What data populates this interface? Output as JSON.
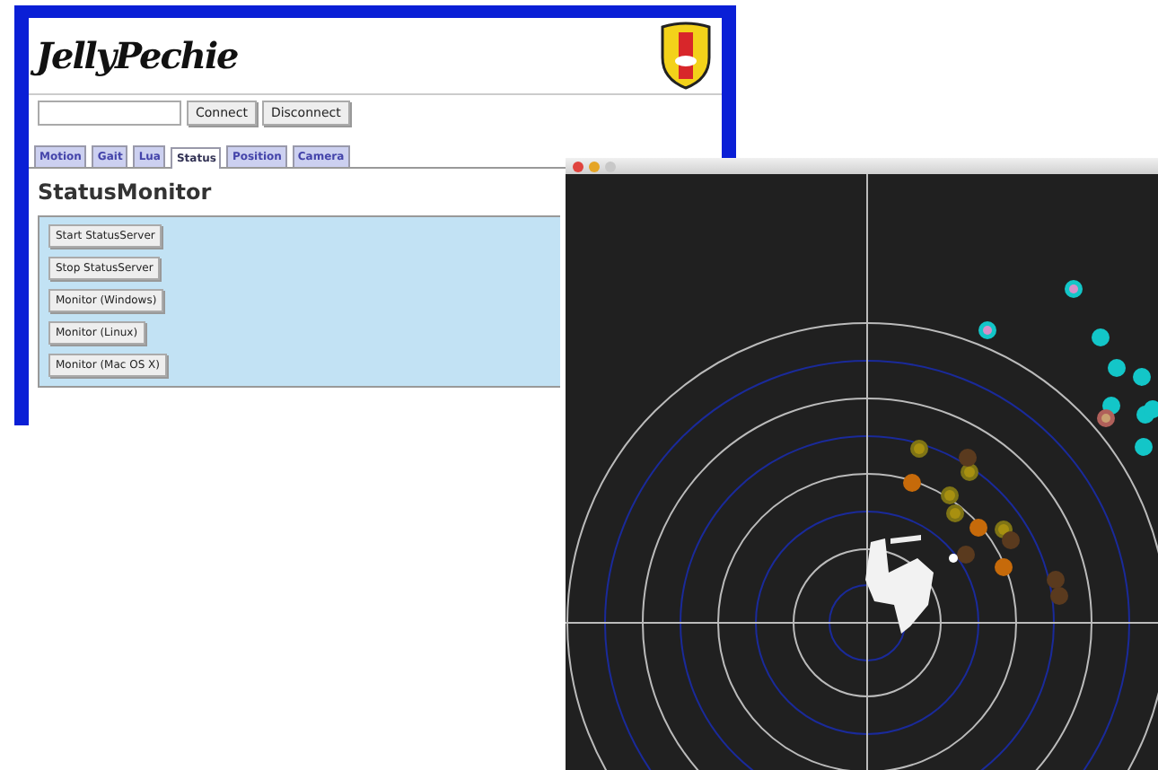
{
  "browser": {
    "logo": "JellyPechie",
    "connection": {
      "buttons": [
        "Connect",
        "Disconnect"
      ]
    },
    "tabs": [
      {
        "label": "Motion",
        "selected": false
      },
      {
        "label": "Gait",
        "selected": false
      },
      {
        "label": "Lua",
        "selected": false
      },
      {
        "label": "Status",
        "selected": true
      },
      {
        "label": "Position",
        "selected": false
      },
      {
        "label": "Camera",
        "selected": false
      }
    ],
    "heading": "StatusMonitor",
    "buttons": [
      "Start StatusServer",
      "Stop StatusServer",
      "Monitor (Windows)",
      "Monitor (Linux)",
      "Monitor (Mac OS X)"
    ]
  }
}
